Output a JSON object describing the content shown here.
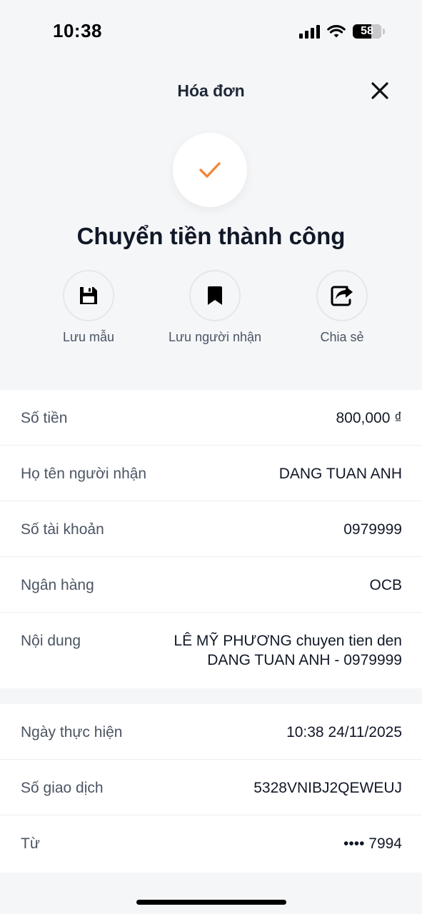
{
  "status": {
    "time": "10:38",
    "battery": "58"
  },
  "header": {
    "title": "Hóa đơn"
  },
  "success": {
    "title": "Chuyển tiền thành công"
  },
  "actions": [
    {
      "label": "Lưu mẫu",
      "icon": "floppy-disk-icon"
    },
    {
      "label": "Lưu người nhận",
      "icon": "bookmark-icon"
    },
    {
      "label": "Chia sẻ",
      "icon": "share-icon"
    }
  ],
  "details": [
    {
      "label": "Số tiền",
      "value": "800,000 ₫"
    },
    {
      "label": "Họ tên người nhận",
      "value": "DANG TUAN ANH"
    },
    {
      "label": "Số tài khoản",
      "value": "0979999"
    },
    {
      "label": "Ngân hàng",
      "value": "OCB"
    },
    {
      "label": "Nội dung",
      "value": "LÊ MỸ PHƯƠNG chuyen tien den DANG TUAN ANH - 0979999"
    }
  ],
  "transaction": [
    {
      "label": "Ngày thực hiện",
      "value": "10:38 24/11/2025"
    },
    {
      "label": "Số giao dịch",
      "value": "5328VNIBJ2QEWEUJ"
    },
    {
      "label": "Từ",
      "value": "•••• 7994"
    }
  ],
  "colors": {
    "accent": "#f0873a",
    "background": "#f5f6f8"
  }
}
